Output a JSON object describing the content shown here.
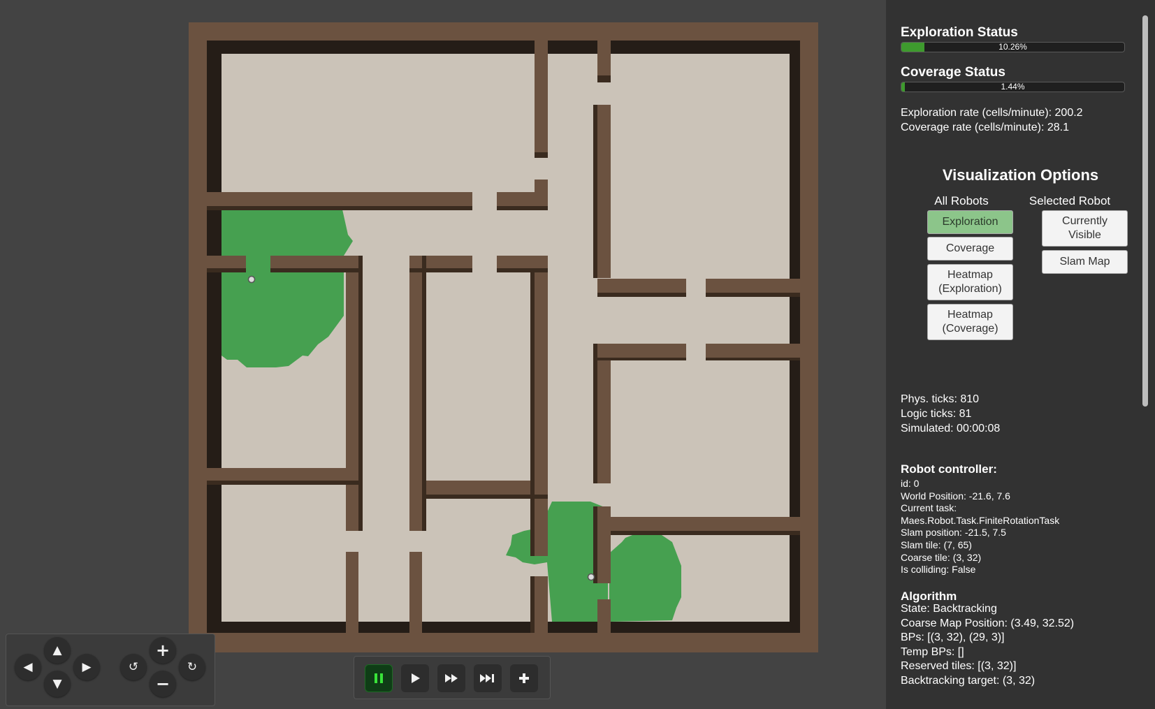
{
  "exploration": {
    "title": "Exploration Status",
    "percent_label": "10.26%",
    "fraction": 0.1026
  },
  "coverage": {
    "title": "Coverage Status",
    "percent_label": "1.44%",
    "fraction": 0.0144
  },
  "rates": {
    "exploration_rate": "Exploration rate (cells/minute): 200.2",
    "coverage_rate": "Coverage rate (cells/minute): 28.1"
  },
  "visualization": {
    "title": "Visualization Options",
    "all_robots_label": "All Robots",
    "selected_robot_label": "Selected Robot",
    "all_robots_buttons": [
      "Exploration",
      "Coverage",
      "Heatmap\n(Exploration)",
      "Heatmap\n(Coverage)"
    ],
    "selected_robot_buttons": [
      "Currently\nVisible",
      "Slam Map"
    ],
    "active_button": "Exploration"
  },
  "ticks": {
    "phys": "Phys. ticks: 810",
    "logic": "Logic ticks: 81",
    "simulated": "Simulated: 00:00:08"
  },
  "robot_controller": {
    "title": "Robot controller:",
    "lines": [
      "id: 0",
      "World Position: -21.6, 7.6",
      "Current task:",
      "Maes.Robot.Task.FiniteRotationTask",
      "Slam position: -21.5, 7.5",
      "Slam tile: (7, 65)",
      "Coarse tile: (3, 32)",
      "Is colliding: False"
    ]
  },
  "algorithm": {
    "title": "Algorithm",
    "lines": [
      "State: Backtracking",
      "Coarse Map Position: (3.49, 32.52)",
      "BPs: [(3, 32), (29, 3)]",
      "Temp BPs: []",
      "Reserved tiles: [(3, 32)]",
      "Backtracking target: (3, 32)"
    ]
  },
  "camera_controls": {
    "up_icon": "▲",
    "down_icon": "▼",
    "left_icon": "◀",
    "right_icon": "▶",
    "rotate_left_icon": "↺",
    "rotate_right_icon": "↻",
    "zoom_in_icon": "+",
    "zoom_out_icon": "−"
  },
  "playback_controls": {
    "buttons": [
      "pause-icon",
      "play-icon",
      "fast-forward-icon",
      "skip-forward-icon",
      "add-icon"
    ],
    "active": "pause-icon"
  },
  "colors": {
    "background": "#424242",
    "floor": "#cbc3b8",
    "wall_top": "#6b5240",
    "wall_side": "#3a2b1f",
    "explored": "#46a050",
    "progress": "#3e9a2e",
    "panel": "#323232"
  }
}
